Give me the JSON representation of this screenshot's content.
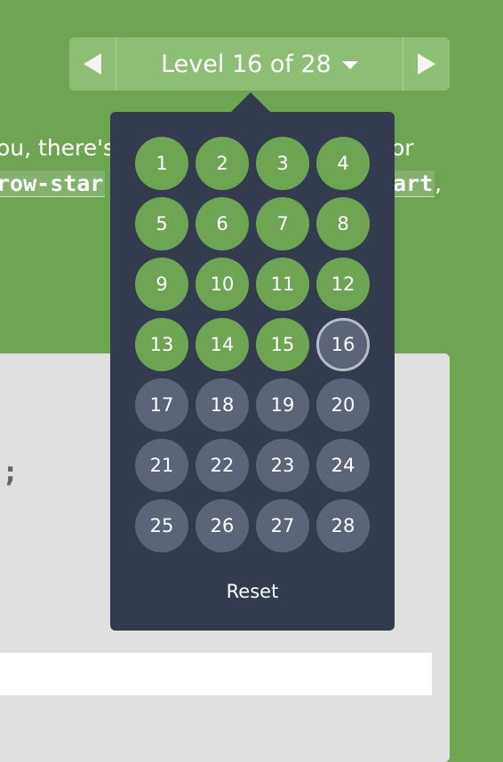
{
  "nav": {
    "level_label": "Level 16 of 28"
  },
  "background_text": {
    "line1_left": "ou, there's",
    "line1_right": "or",
    "line2_left_code": "row-star",
    "line2_right_code": "art",
    "line2_trailing": ","
  },
  "editor": {
    "visible_code": ";"
  },
  "dropdown": {
    "levels": [
      {
        "number": "1",
        "state": "solved"
      },
      {
        "number": "2",
        "state": "solved"
      },
      {
        "number": "3",
        "state": "solved"
      },
      {
        "number": "4",
        "state": "solved"
      },
      {
        "number": "5",
        "state": "solved"
      },
      {
        "number": "6",
        "state": "solved"
      },
      {
        "number": "7",
        "state": "solved"
      },
      {
        "number": "8",
        "state": "solved"
      },
      {
        "number": "9",
        "state": "solved"
      },
      {
        "number": "10",
        "state": "solved"
      },
      {
        "number": "11",
        "state": "solved"
      },
      {
        "number": "12",
        "state": "solved"
      },
      {
        "number": "13",
        "state": "solved"
      },
      {
        "number": "14",
        "state": "solved"
      },
      {
        "number": "15",
        "state": "solved"
      },
      {
        "number": "16",
        "state": "current"
      },
      {
        "number": "17",
        "state": "unsolved"
      },
      {
        "number": "18",
        "state": "unsolved"
      },
      {
        "number": "19",
        "state": "unsolved"
      },
      {
        "number": "20",
        "state": "unsolved"
      },
      {
        "number": "21",
        "state": "unsolved"
      },
      {
        "number": "22",
        "state": "unsolved"
      },
      {
        "number": "23",
        "state": "unsolved"
      },
      {
        "number": "24",
        "state": "unsolved"
      },
      {
        "number": "25",
        "state": "unsolved"
      },
      {
        "number": "26",
        "state": "unsolved"
      },
      {
        "number": "27",
        "state": "unsolved"
      },
      {
        "number": "28",
        "state": "unsolved"
      }
    ],
    "reset_label": "Reset"
  },
  "colors": {
    "page_background": "#6ea553",
    "solved": "#6ea553",
    "unsolved": "#5c6577",
    "dropdown_background": "#323c4e",
    "editor_background": "#e0e0e0"
  },
  "icons": {
    "prev": "triangle-left-icon",
    "next": "triangle-right-icon",
    "dropdown": "caret-down-icon"
  }
}
